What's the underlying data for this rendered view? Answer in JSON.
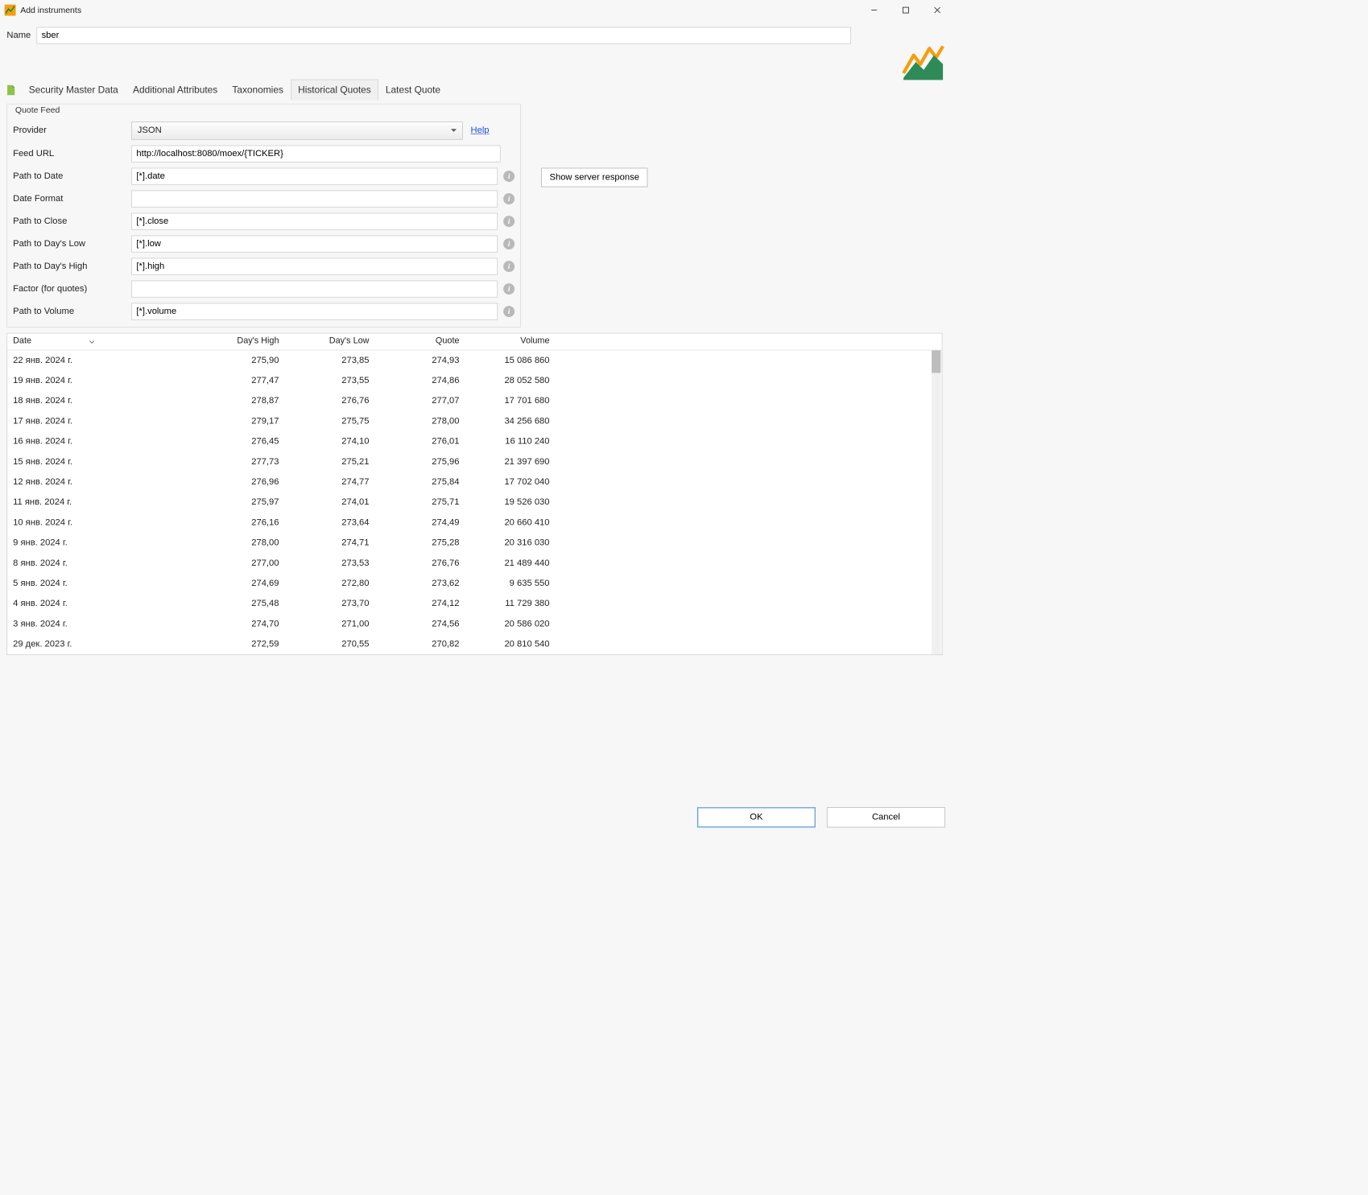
{
  "window": {
    "title": "Add instruments"
  },
  "name": {
    "label": "Name",
    "value": "sber"
  },
  "tabs": [
    {
      "label": "Security Master Data",
      "active": false
    },
    {
      "label": "Additional Attributes",
      "active": false
    },
    {
      "label": "Taxonomies",
      "active": false
    },
    {
      "label": "Historical Quotes",
      "active": true
    },
    {
      "label": "Latest Quote",
      "active": false
    }
  ],
  "quoteFeed": {
    "legend": "Quote Feed",
    "provider_label": "Provider",
    "provider_value": "JSON",
    "help": "Help",
    "server_response": "Show server response",
    "fields": {
      "feed_url": {
        "label": "Feed URL",
        "value": "http://localhost:8080/moex/{TICKER}",
        "info": false
      },
      "path_date": {
        "label": "Path to Date",
        "value": "[*].date",
        "info": true
      },
      "date_fmt": {
        "label": "Date Format",
        "value": "",
        "info": true
      },
      "path_close": {
        "label": "Path to Close",
        "value": "[*].close",
        "info": true
      },
      "path_low": {
        "label": "Path to Day's Low",
        "value": "[*].low",
        "info": true
      },
      "path_high": {
        "label": "Path to Day's High",
        "value": "[*].high",
        "info": true
      },
      "factor": {
        "label": "Factor (for quotes)",
        "value": "",
        "info": true
      },
      "path_vol": {
        "label": "Path to Volume",
        "value": "[*].volume",
        "info": true
      }
    }
  },
  "table": {
    "columns": {
      "date": "Date",
      "high": "Day's High",
      "low": "Day's Low",
      "quote": "Quote",
      "volume": "Volume"
    },
    "rows": [
      {
        "date": "22 янв. 2024 г.",
        "high": "275,90",
        "low": "273,85",
        "quote": "274,93",
        "volume": "15 086 860"
      },
      {
        "date": "19 янв. 2024 г.",
        "high": "277,47",
        "low": "273,55",
        "quote": "274,86",
        "volume": "28 052 580"
      },
      {
        "date": "18 янв. 2024 г.",
        "high": "278,87",
        "low": "276,76",
        "quote": "277,07",
        "volume": "17 701 680"
      },
      {
        "date": "17 янв. 2024 г.",
        "high": "279,17",
        "low": "275,75",
        "quote": "278,00",
        "volume": "34 256 680"
      },
      {
        "date": "16 янв. 2024 г.",
        "high": "276,45",
        "low": "274,10",
        "quote": "276,01",
        "volume": "16 110 240"
      },
      {
        "date": "15 янв. 2024 г.",
        "high": "277,73",
        "low": "275,21",
        "quote": "275,96",
        "volume": "21 397 690"
      },
      {
        "date": "12 янв. 2024 г.",
        "high": "276,96",
        "low": "274,77",
        "quote": "275,84",
        "volume": "17 702 040"
      },
      {
        "date": "11 янв. 2024 г.",
        "high": "275,97",
        "low": "274,01",
        "quote": "275,71",
        "volume": "19 526 030"
      },
      {
        "date": "10 янв. 2024 г.",
        "high": "276,16",
        "low": "273,64",
        "quote": "274,49",
        "volume": "20 660 410"
      },
      {
        "date": "9 янв. 2024 г.",
        "high": "278,00",
        "low": "274,71",
        "quote": "275,28",
        "volume": "20 316 030"
      },
      {
        "date": "8 янв. 2024 г.",
        "high": "277,00",
        "low": "273,53",
        "quote": "276,76",
        "volume": "21 489 440"
      },
      {
        "date": "5 янв. 2024 г.",
        "high": "274,69",
        "low": "272,80",
        "quote": "273,62",
        "volume": "9 635 550"
      },
      {
        "date": "4 янв. 2024 г.",
        "high": "275,48",
        "low": "273,70",
        "quote": "274,12",
        "volume": "11 729 380"
      },
      {
        "date": "3 янв. 2024 г.",
        "high": "274,70",
        "low": "271,00",
        "quote": "274,56",
        "volume": "20 586 020"
      },
      {
        "date": "29 дек. 2023 г.",
        "high": "272,59",
        "low": "270,55",
        "quote": "270,82",
        "volume": "20 810 540"
      }
    ]
  },
  "buttons": {
    "ok": "OK",
    "cancel": "Cancel"
  }
}
